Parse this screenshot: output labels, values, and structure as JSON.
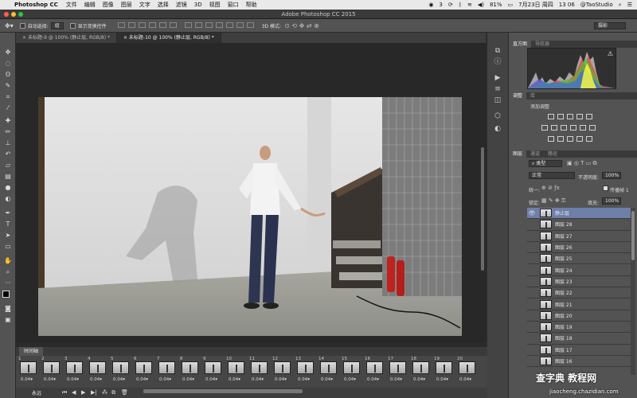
{
  "menubar": {
    "app": "Photoshop CC",
    "menus": [
      "文件",
      "编辑",
      "图像",
      "图层",
      "文字",
      "选择",
      "滤镜",
      "3D",
      "视图",
      "窗口",
      "帮助"
    ],
    "status": {
      "badge": "3",
      "battery": "81%",
      "date": "7月23日 周四",
      "time": "13 06",
      "user": "@TaoStudio"
    }
  },
  "window": {
    "title": "Adobe Photoshop CC 2015"
  },
  "options": {
    "auto_select": "自动选择:",
    "auto_select_value": "组",
    "show_transform": "显示变换控件",
    "mode3d": "3D 模式:",
    "workspace": "摄影"
  },
  "tabs": [
    {
      "label": "未标题-9 @ 100% (静止层, RGB/8) *",
      "active": false
    },
    {
      "label": "未标题-10 @ 100% (静止层, RGB/8) *",
      "active": true
    }
  ],
  "panels": {
    "histogram_tabs": [
      "直方图",
      "导航器"
    ],
    "adjust_tabs": [
      "调整",
      "库"
    ],
    "adjust_title": "添加调整",
    "layers_tabs": [
      "图层",
      "通道",
      "路径"
    ],
    "kind": "类型",
    "blend": "正常",
    "opacity_label": "不透明度:",
    "opacity": "100%",
    "unify": "统一:",
    "propagate": "传播帧 1",
    "lock": "锁定:",
    "fill_label": "填充:",
    "fill": "100%"
  },
  "layers": [
    {
      "name": "静止层",
      "selected": true
    },
    {
      "name": "图层 28"
    },
    {
      "name": "图层 27"
    },
    {
      "name": "图层 26"
    },
    {
      "name": "图层 25"
    },
    {
      "name": "图层 24"
    },
    {
      "name": "图层 23"
    },
    {
      "name": "图层 22"
    },
    {
      "name": "图层 21"
    },
    {
      "name": "图层 20"
    },
    {
      "name": "图层 19"
    },
    {
      "name": "图层 18"
    },
    {
      "name": "图层 17"
    },
    {
      "name": "图层 16"
    }
  ],
  "timeline": {
    "title": "时间轴",
    "loop": "永远",
    "frames": [
      {
        "n": "1",
        "d": "0.04"
      },
      {
        "n": "2",
        "d": "0.04"
      },
      {
        "n": "3",
        "d": "0.04"
      },
      {
        "n": "4",
        "d": "0.04"
      },
      {
        "n": "5",
        "d": "0.04"
      },
      {
        "n": "6",
        "d": "0.04"
      },
      {
        "n": "7",
        "d": "0.04"
      },
      {
        "n": "8",
        "d": "0.04"
      },
      {
        "n": "9",
        "d": "0.04"
      },
      {
        "n": "10",
        "d": "0.04"
      },
      {
        "n": "11",
        "d": "0.04"
      },
      {
        "n": "12",
        "d": "0.04"
      },
      {
        "n": "13",
        "d": "0.04"
      },
      {
        "n": "14",
        "d": "0.04"
      },
      {
        "n": "15",
        "d": "0.04"
      },
      {
        "n": "16",
        "d": "0.04"
      },
      {
        "n": "17",
        "d": "0.04"
      },
      {
        "n": "18",
        "d": "0.04"
      },
      {
        "n": "19",
        "d": "0.04"
      },
      {
        "n": "20",
        "d": "0.04"
      }
    ]
  },
  "watermark": {
    "line1": "查字典 教程网",
    "line2": "jiaocheng.chazidian.com"
  }
}
